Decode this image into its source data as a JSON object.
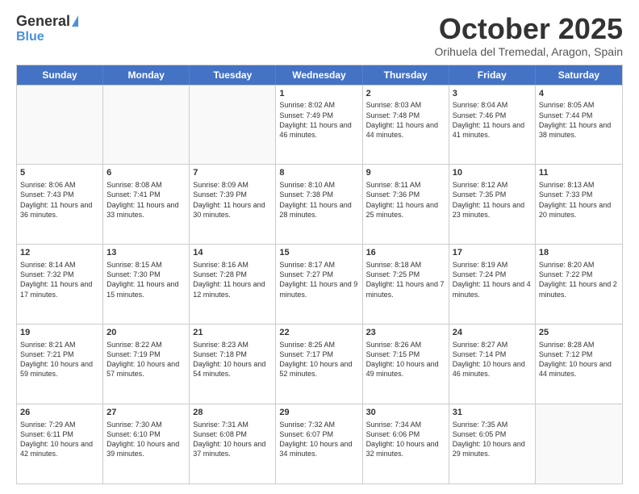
{
  "header": {
    "logo_general": "General",
    "logo_blue": "Blue",
    "month": "October 2025",
    "location": "Orihuela del Tremedal, Aragon, Spain"
  },
  "weekdays": [
    "Sunday",
    "Monday",
    "Tuesday",
    "Wednesday",
    "Thursday",
    "Friday",
    "Saturday"
  ],
  "weeks": [
    [
      {
        "day": "",
        "info": ""
      },
      {
        "day": "",
        "info": ""
      },
      {
        "day": "",
        "info": ""
      },
      {
        "day": "1",
        "info": "Sunrise: 8:02 AM\nSunset: 7:49 PM\nDaylight: 11 hours and 46 minutes."
      },
      {
        "day": "2",
        "info": "Sunrise: 8:03 AM\nSunset: 7:48 PM\nDaylight: 11 hours and 44 minutes."
      },
      {
        "day": "3",
        "info": "Sunrise: 8:04 AM\nSunset: 7:46 PM\nDaylight: 11 hours and 41 minutes."
      },
      {
        "day": "4",
        "info": "Sunrise: 8:05 AM\nSunset: 7:44 PM\nDaylight: 11 hours and 38 minutes."
      }
    ],
    [
      {
        "day": "5",
        "info": "Sunrise: 8:06 AM\nSunset: 7:43 PM\nDaylight: 11 hours and 36 minutes."
      },
      {
        "day": "6",
        "info": "Sunrise: 8:08 AM\nSunset: 7:41 PM\nDaylight: 11 hours and 33 minutes."
      },
      {
        "day": "7",
        "info": "Sunrise: 8:09 AM\nSunset: 7:39 PM\nDaylight: 11 hours and 30 minutes."
      },
      {
        "day": "8",
        "info": "Sunrise: 8:10 AM\nSunset: 7:38 PM\nDaylight: 11 hours and 28 minutes."
      },
      {
        "day": "9",
        "info": "Sunrise: 8:11 AM\nSunset: 7:36 PM\nDaylight: 11 hours and 25 minutes."
      },
      {
        "day": "10",
        "info": "Sunrise: 8:12 AM\nSunset: 7:35 PM\nDaylight: 11 hours and 23 minutes."
      },
      {
        "day": "11",
        "info": "Sunrise: 8:13 AM\nSunset: 7:33 PM\nDaylight: 11 hours and 20 minutes."
      }
    ],
    [
      {
        "day": "12",
        "info": "Sunrise: 8:14 AM\nSunset: 7:32 PM\nDaylight: 11 hours and 17 minutes."
      },
      {
        "day": "13",
        "info": "Sunrise: 8:15 AM\nSunset: 7:30 PM\nDaylight: 11 hours and 15 minutes."
      },
      {
        "day": "14",
        "info": "Sunrise: 8:16 AM\nSunset: 7:28 PM\nDaylight: 11 hours and 12 minutes."
      },
      {
        "day": "15",
        "info": "Sunrise: 8:17 AM\nSunset: 7:27 PM\nDaylight: 11 hours and 9 minutes."
      },
      {
        "day": "16",
        "info": "Sunrise: 8:18 AM\nSunset: 7:25 PM\nDaylight: 11 hours and 7 minutes."
      },
      {
        "day": "17",
        "info": "Sunrise: 8:19 AM\nSunset: 7:24 PM\nDaylight: 11 hours and 4 minutes."
      },
      {
        "day": "18",
        "info": "Sunrise: 8:20 AM\nSunset: 7:22 PM\nDaylight: 11 hours and 2 minutes."
      }
    ],
    [
      {
        "day": "19",
        "info": "Sunrise: 8:21 AM\nSunset: 7:21 PM\nDaylight: 10 hours and 59 minutes."
      },
      {
        "day": "20",
        "info": "Sunrise: 8:22 AM\nSunset: 7:19 PM\nDaylight: 10 hours and 57 minutes."
      },
      {
        "day": "21",
        "info": "Sunrise: 8:23 AM\nSunset: 7:18 PM\nDaylight: 10 hours and 54 minutes."
      },
      {
        "day": "22",
        "info": "Sunrise: 8:25 AM\nSunset: 7:17 PM\nDaylight: 10 hours and 52 minutes."
      },
      {
        "day": "23",
        "info": "Sunrise: 8:26 AM\nSunset: 7:15 PM\nDaylight: 10 hours and 49 minutes."
      },
      {
        "day": "24",
        "info": "Sunrise: 8:27 AM\nSunset: 7:14 PM\nDaylight: 10 hours and 46 minutes."
      },
      {
        "day": "25",
        "info": "Sunrise: 8:28 AM\nSunset: 7:12 PM\nDaylight: 10 hours and 44 minutes."
      }
    ],
    [
      {
        "day": "26",
        "info": "Sunrise: 7:29 AM\nSunset: 6:11 PM\nDaylight: 10 hours and 42 minutes."
      },
      {
        "day": "27",
        "info": "Sunrise: 7:30 AM\nSunset: 6:10 PM\nDaylight: 10 hours and 39 minutes."
      },
      {
        "day": "28",
        "info": "Sunrise: 7:31 AM\nSunset: 6:08 PM\nDaylight: 10 hours and 37 minutes."
      },
      {
        "day": "29",
        "info": "Sunrise: 7:32 AM\nSunset: 6:07 PM\nDaylight: 10 hours and 34 minutes."
      },
      {
        "day": "30",
        "info": "Sunrise: 7:34 AM\nSunset: 6:06 PM\nDaylight: 10 hours and 32 minutes."
      },
      {
        "day": "31",
        "info": "Sunrise: 7:35 AM\nSunset: 6:05 PM\nDaylight: 10 hours and 29 minutes."
      },
      {
        "day": "",
        "info": ""
      }
    ]
  ]
}
